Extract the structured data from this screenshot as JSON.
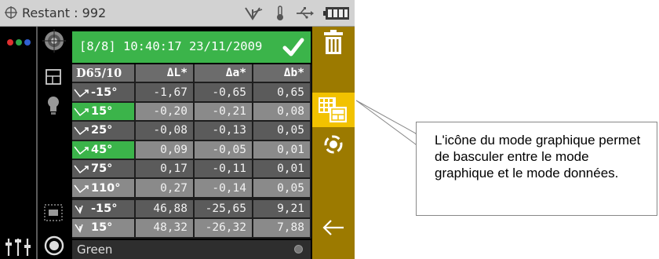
{
  "status": {
    "remaining": "Restant : 992",
    "icons": [
      "target-icon",
      "antenna-icon",
      "temperature-icon",
      "usb-icon",
      "battery-icon"
    ]
  },
  "sidebar_left": {
    "icons": [
      "color-dots-icon",
      "settings-sliders-icon"
    ]
  },
  "sidebar_icons": [
    "target-view-icon",
    "grid-layout-icon",
    "lightbulb-icon",
    "pattern-icon",
    "record-icon"
  ],
  "measurement": {
    "header": "[8/8] 10:40:17 23/11/2009",
    "status_icon": "checkmark-icon",
    "columns": [
      "D65/10",
      "ΔL*",
      "Δa*",
      "Δb*"
    ],
    "rows": [
      {
        "angle": "-15°",
        "dL": "-1,67",
        "da": "-0,65",
        "db": "0,65"
      },
      {
        "angle": "15°",
        "dL": "-0,20",
        "da": "-0,21",
        "db": "0,08"
      },
      {
        "angle": "25°",
        "dL": "-0,08",
        "da": "-0,13",
        "db": "0,05"
      },
      {
        "angle": "45°",
        "dL": "0,09",
        "da": "-0,05",
        "db": "0,01"
      },
      {
        "angle": "75°",
        "dL": "0,17",
        "da": "-0,11",
        "db": "0,01"
      },
      {
        "angle": "110°",
        "dL": "0,27",
        "da": "-0,14",
        "db": "0,05"
      },
      {
        "angle": "-15°",
        "dL": "46,88",
        "da": "-25,65",
        "db": "9,21"
      },
      {
        "angle": "15°",
        "dL": "48,32",
        "da": "-26,32",
        "db": "7,88"
      }
    ],
    "sample_name": "Green"
  },
  "right_panel": {
    "icons": [
      "trash-icon",
      "graph-mode-icon",
      "measure-icon",
      "back-arrow-icon"
    ]
  },
  "callout": {
    "text": "L'icône du mode graphique permet de basculer entre le mode graphique et le mode données."
  },
  "colors": {
    "accent_green": "#3bb44a",
    "panel_gold": "#9c7a00",
    "highlight_yellow": "#f2c200"
  }
}
